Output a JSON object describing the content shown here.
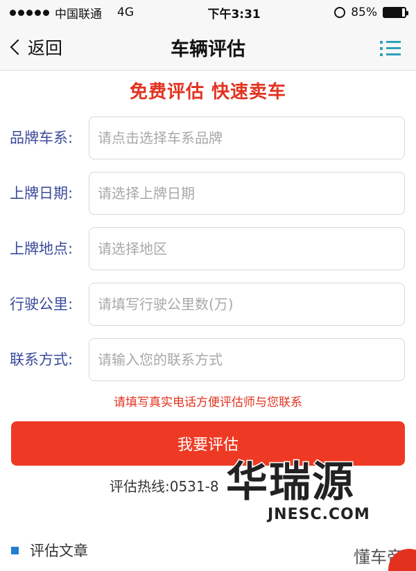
{
  "status": {
    "carrier": "中国联通",
    "network": "4G",
    "time": "下午3:31",
    "battery": "85%",
    "battery_level": 0.85
  },
  "nav": {
    "back_label": "返回",
    "title": "车辆评估"
  },
  "slogan": "免费评估 快速卖车",
  "form": {
    "fields": [
      {
        "label": "品牌车系:",
        "placeholder": "请点击选择车系品牌"
      },
      {
        "label": "上牌日期:",
        "placeholder": "请选择上牌日期"
      },
      {
        "label": "上牌地点:",
        "placeholder": "请选择地区"
      },
      {
        "label": "行驶公里:",
        "placeholder": "请填写行驶公里数(万)"
      },
      {
        "label": "联系方式:",
        "placeholder": "请输入您的联系方式"
      }
    ],
    "hint": "请填写真实电话方便评估师与您联系",
    "submit_label": "我要评估"
  },
  "hotline": "评估热线:0531-8",
  "watermark": {
    "big": "华瑞源",
    "small": "JNESC.COM"
  },
  "section": {
    "title": "评估文章"
  },
  "corner_mark": "懂车帝",
  "colors": {
    "accent_red": "#ee3a24",
    "label_blue": "#3a4a9a",
    "menu_teal": "#2ba0b8"
  }
}
